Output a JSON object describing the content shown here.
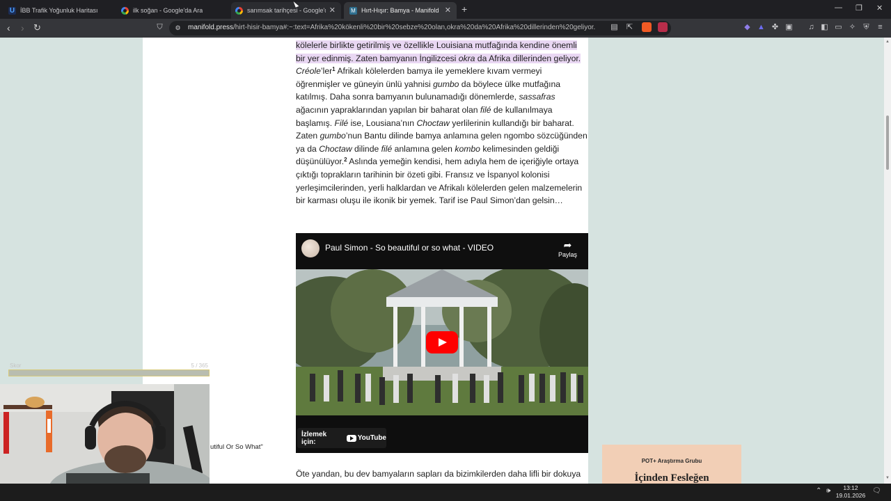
{
  "browser": {
    "tabs": [
      {
        "label": "İBB Trafik Yoğunluk Haritası",
        "icon": "ibb-icon",
        "state": "normal"
      },
      {
        "label": "ilk soğan - Google'da Ara",
        "icon": "google-icon",
        "state": "normal"
      },
      {
        "label": "sarımsak tarihçesi - Google'da Ara",
        "icon": "google-icon",
        "state": "hover"
      },
      {
        "label": "Hırt-Hışır: Bamya - Manifold",
        "icon": "manifold-icon",
        "state": "active"
      }
    ],
    "new_tab": "+",
    "url_host": "manifold.press",
    "url_rest": "/hirt-hisir-bamya#:~:text=Afrika%20kökenli%20bir%20sebze%20olan,okra%20da%20Afrika%20dillerinden%20geliyor.",
    "shields_count": "8",
    "alerts_count": "1"
  },
  "article": {
    "p1_hl1": "kölelerle birlikte getirilmiş ve özellikle Louisiana mutfağında kendine önemli bir yer edinmiş. Zaten bamyanın İngilizcesi ",
    "p1_hl_em": "okra",
    "p1_hl2": " da Afrika dillerinden geliyor.",
    "p1_em_creole": "Créole",
    "p1_t1": "’ler",
    "fn1": "1",
    "p1_t2": " Afrikalı kölelerden bamya ile yemeklere kıvam vermeyi öğrenmişler ve güneyin ünlü yahnisi ",
    "p1_em_gumbo": "gumbo",
    "p1_t3": " da böylece ülke mutfağına katılmış. Daha sonra bamyanın bulunamadığı dönemlerde, ",
    "p1_em_sassafras": "sassafras",
    "p1_t4": " ağacının yapraklarından yapılan bir baharat olan ",
    "p1_em_file": "filé",
    "p1_t5": " de kullanılmaya başlamış. ",
    "p1_em_file2": "Filé",
    "p1_t6": " ise, Lousiana’nın ",
    "p1_em_choctaw": "Choctaw",
    "p1_t7": " yerlilerinin kullandığı bir baharat. Zaten ",
    "p1_em_gumbo2": "gumbo",
    "p1_t8": "’nun Bantu dilinde bamya anlamına gelen ngombo sözcüğünden ya da ",
    "p1_em_choctaw2": "Choctaw",
    "p1_t9": " dilinde ",
    "p1_em_file3": "filé",
    "p1_t10": " anlamına gelen ",
    "p1_em_kombo": "kombo",
    "p1_t11": " kelimesinden geldiği düşünülüyor.",
    "fn2": "2",
    "p1_t12": " Aslında yemeğin kendisi, hem adıyla hem de içeriğiyle ortaya çıktığı toprakların tarihinin bir özeti gibi. Fransız ve İspanyol kolonisi yerleşimcilerinden, yerli halklardan ve Afrikalı kölelerden gelen malzemelerin bir karması oluşu ile ikonik bir yemek. Tarif ise Paul Simon’dan gelsin…",
    "p2": "Öte yandan, bu dev bamyaların sapları da bizimkilerden daha lifli bir dokuya"
  },
  "video": {
    "title": "Paul Simon - So beautiful or so what - VIDEO",
    "share_label": "Paylaş",
    "watch_label": "İzlemek için:",
    "youtube_label": "YouTube"
  },
  "promo": {
    "kicker": "POT+ Araştırma Grubu",
    "title": "İçinden Fesleğen"
  },
  "overlay": {
    "progress_label": "Skor",
    "progress_value": "5 / 365",
    "caption_fragment": "utiful Or So What\""
  },
  "taskbar": {
    "time": "13:12",
    "date": "19.01.2026",
    "notif_count": "5"
  },
  "colors": {
    "page_bg": "#d6e3e0",
    "highlight": "#e9d7f3",
    "youtube_red": "#ff0000",
    "promo_bg": "#f2cfb6"
  }
}
